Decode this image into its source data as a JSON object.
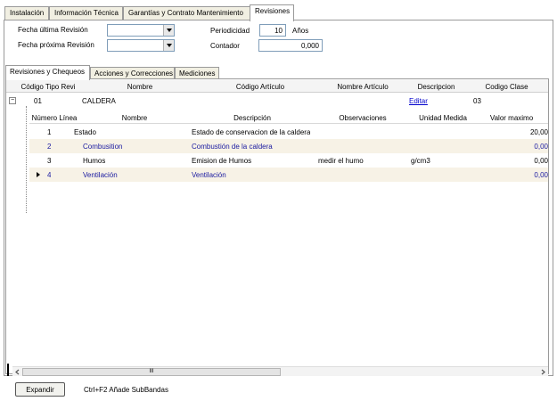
{
  "tabs": [
    "Instalación",
    "Información Técnica",
    "Garantías y Contrato Mantenimiento",
    "Revisiones"
  ],
  "form": {
    "fecha_ultima_label": "Fecha última Revisión",
    "fecha_proxima_label": "Fecha próxima Revisión",
    "periodicidad_label": "Periodicidad",
    "periodicidad_value": "10",
    "periodicidad_unit": "Años",
    "contador_label": "Contador",
    "contador_value": "0,000"
  },
  "inner_tabs": [
    "Revisiones y Chequeos",
    "Acciones y Correcciones",
    "Mediciones"
  ],
  "band0": {
    "headers": [
      "Código Tipo Revi",
      "Nombre",
      "Código Artículo",
      "Nombre Artículo",
      "Descripcion",
      "Codigo Clase"
    ],
    "row": {
      "codigo": "01",
      "nombre": "CALDERA",
      "codigo_articulo": "",
      "nombre_articulo": "",
      "descripcion": "Editar",
      "codigo_clase": "03"
    }
  },
  "band1": {
    "headers": [
      "Número Línea",
      "Nombre",
      "Descripción",
      "Observaciones",
      "Unidad Medida",
      "Valor maximo"
    ],
    "rows": [
      {
        "num": "1",
        "nombre": "Estado",
        "descripcion": "Estado de conservacion de la caldera",
        "obs": "",
        "unidad": "",
        "valor": "20,00"
      },
      {
        "num": "2",
        "nombre": "Combusition",
        "descripcion": "Combustión de la caldera",
        "obs": "",
        "unidad": "",
        "valor": "0,00"
      },
      {
        "num": "3",
        "nombre": "Humos",
        "descripcion": "Emision de Humos",
        "obs": "medir el humo",
        "unidad": "g/cm3",
        "valor": "0,00"
      },
      {
        "num": "4",
        "nombre": "Ventilación",
        "descripcion": "Ventilación",
        "obs": "",
        "unidad": "",
        "valor": "0,00"
      }
    ]
  },
  "scroll_thumb_label": "III",
  "expand_button": "Expandir",
  "hint": "Ctrl+F2 Añade SubBandas",
  "colors": {
    "alt_row": "#f7f2e6",
    "link": "#0000cc",
    "row_text_alt": "#1a1aa0"
  }
}
